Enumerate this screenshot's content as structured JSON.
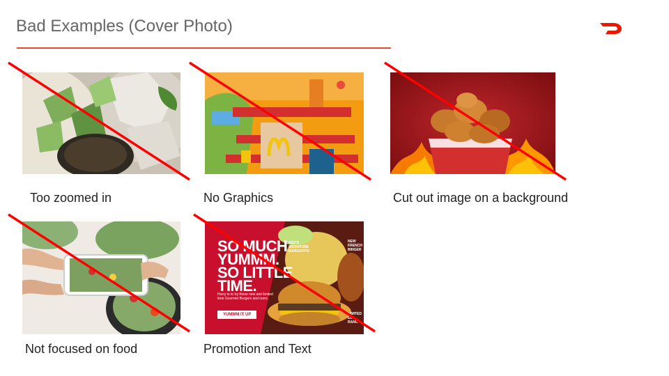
{
  "slide": {
    "title": "Bad Examples (Cover Photo)"
  },
  "colors": {
    "accent": "#e8452c",
    "strike": "#ff0000",
    "brand": "#eb1700",
    "title": "#666666"
  },
  "logo": {
    "icon": "doordash-logo-icon"
  },
  "examples": [
    {
      "caption": "Too zoomed in"
    },
    {
      "caption": "No Graphics"
    },
    {
      "caption": "Cut out image on a background"
    },
    {
      "caption": "Not focused on food"
    },
    {
      "caption": "Promotion and Text"
    }
  ],
  "promo": {
    "headline_1": "SO MUCH",
    "headline_2": "YUMMM.",
    "headline_3": "SO LITTLE",
    "headline_4": "TIME.",
    "body": "Hurry in to try these new and limited time Gourmet Burgers and more.",
    "button": "YUMMM IT UP",
    "tag_top": "RED'S SIGNATURE MARGARITA",
    "tag_new": "NEW FRENCH BINGER",
    "tag_limited": "LIMITED EL RANC"
  }
}
